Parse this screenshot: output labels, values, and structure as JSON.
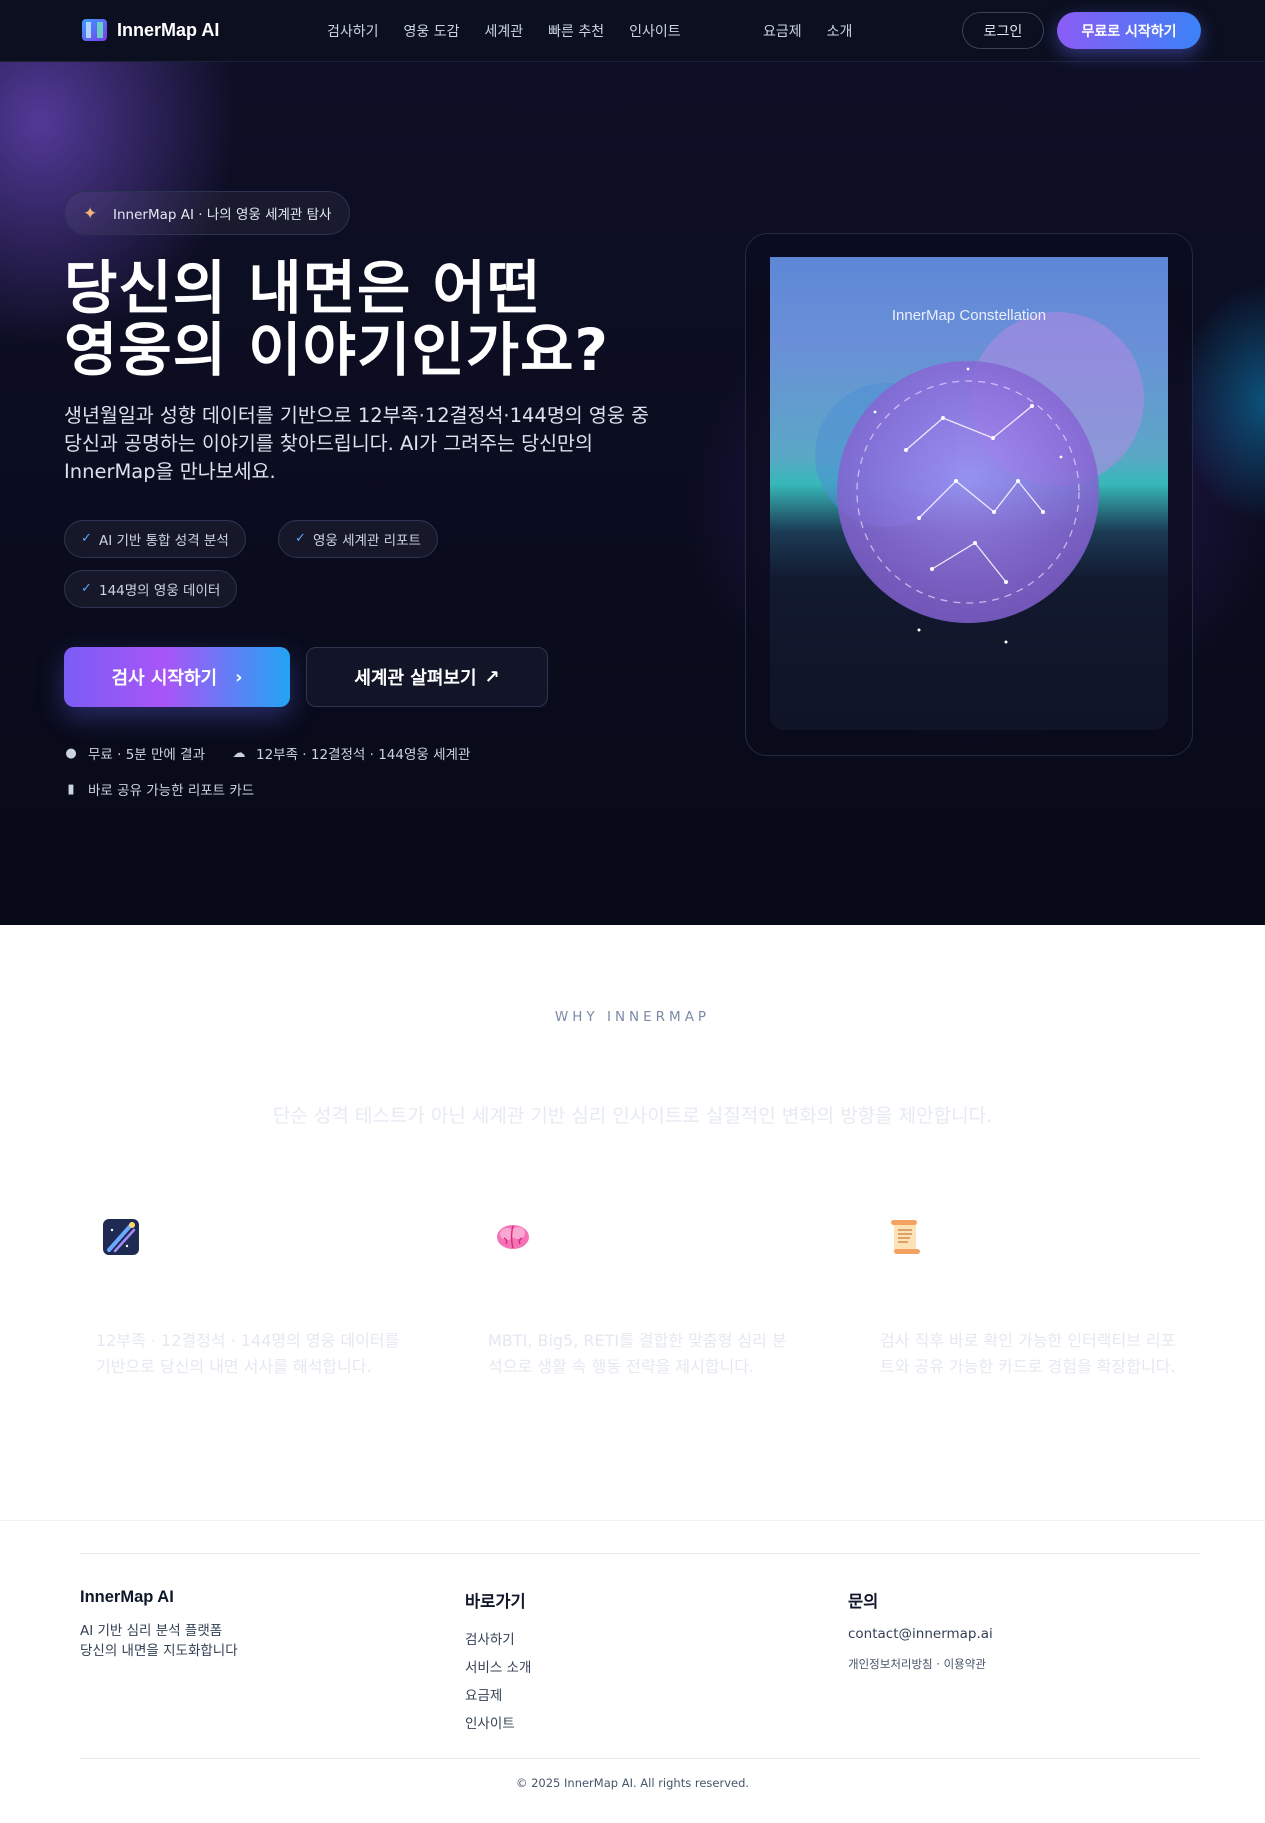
{
  "nav": {
    "brand": "InnerMap AI",
    "menu": [
      "검사하기",
      "영웅 도감",
      "세계관",
      "빠른 추천",
      "인사이트"
    ],
    "menu_right": [
      "요금제",
      "소개"
    ],
    "login": "로그인",
    "cta": "무료로 시작하기"
  },
  "hero": {
    "pill": "InnerMap AI · 나의 영웅 세계관 탐사",
    "headline_line1": "당신의 내면은 어떤",
    "headline_line2": "영웅의 이야기인가요?",
    "description": "생년월일과 성향 데이터를 기반으로 12부족·12결정석·144명의 영웅 중 당신과 공명하는 이야기를 찾아드립니다. AI가 그려주는 당신만의 InnerMap을 만나보세요.",
    "chips": [
      "AI 기반 통합 성격 분석",
      "영웅 세계관 리포트",
      "144명의 영웅 데이터"
    ],
    "cta_primary": "검사 시작하기",
    "cta_secondary": "세계관 살펴보기",
    "meta": [
      "무료 · 5분 만에 결과",
      "12부족 · 12결정석 · 144영웅 세계관",
      "바로 공유 가능한 리포트 카드"
    ],
    "card_title": "InnerMap Constellation"
  },
  "why": {
    "label": "WHY INNERMAP",
    "subtitle": "단순 성격 테스트가 아닌 세계관 기반 심리 인사이트로 실질적인 변화의 방향을 제안합니다.",
    "features": [
      {
        "icon": "meteor-icon",
        "text": "12부족 · 12결정석 · 144명의 영웅 데이터를 기반으로 당신의 내면 서사를 해석합니다."
      },
      {
        "icon": "brain-icon",
        "text": "MBTI, Big5, RETI를 결합한 맞춤형 심리 분석으로 생활 속 행동 전략을 제시합니다."
      },
      {
        "icon": "scroll-icon",
        "text": "검사 직후 바로 확인 가능한 인터랙티브 리포트와 공유 가능한 카드로 경험을 확장합니다."
      }
    ]
  },
  "footer": {
    "brand": "InnerMap AI",
    "desc_line1": "AI 기반 심리 분석 플랫폼",
    "desc_line2": "당신의 내면을 지도화합니다",
    "links_title": "바로가기",
    "links": [
      "검사하기",
      "서비스 소개",
      "요금제",
      "인사이트"
    ],
    "contact_title": "문의",
    "email": "contact@innermap.ai",
    "policy": "개인정보처리방침 · 이용약관",
    "copyright": "© 2025 InnerMap AI. All rights reserved."
  },
  "colors": {
    "accent_purple": "#8b5cf6",
    "accent_blue": "#3b82f6",
    "hero_bg": "#0a0c1e"
  }
}
